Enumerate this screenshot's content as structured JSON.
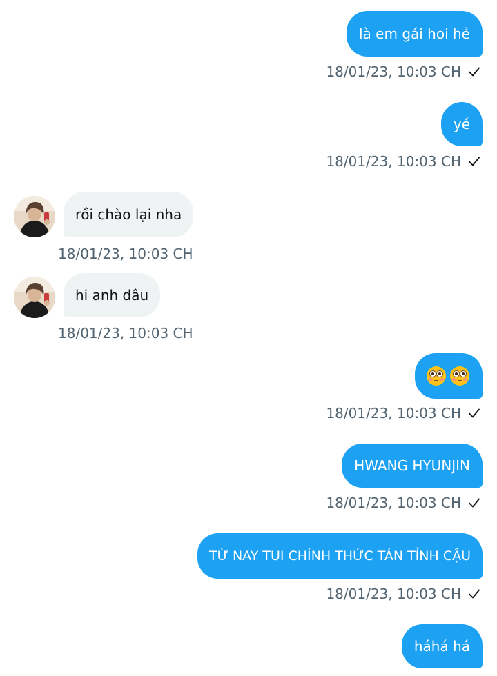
{
  "messages": [
    {
      "side": "sent",
      "text": "là em gái hoi hẻ",
      "time": "18/01/23,  10:03 CH"
    },
    {
      "side": "sent",
      "text": "yé",
      "time": "18/01/23,  10:03 CH"
    },
    {
      "side": "received",
      "text": "rồi chào lại nha",
      "time": "18/01/23,  10:03 CH"
    },
    {
      "side": "received",
      "text": "hi anh dâu",
      "time": "18/01/23,  10:03 CH"
    },
    {
      "side": "sent",
      "emoji": [
        "flushed-face",
        "flushed-face"
      ],
      "time": "18/01/23,  10:03 CH"
    },
    {
      "side": "sent",
      "text": "HWANG HYUNJIN",
      "time": "18/01/23,  10:03 CH"
    },
    {
      "side": "sent",
      "text": "TỪ NAY TUI CHÍNH THỨC TÁN TỈNH CẬU",
      "time": "18/01/23,  10:03 CH"
    },
    {
      "side": "sent",
      "text": "háhá há",
      "time": ""
    }
  ],
  "colors": {
    "sent_bubble": "#1da1f2",
    "received_bubble": "#eff3f4",
    "timestamp": "#536471"
  },
  "icons": {
    "read_status": "check-icon",
    "avatar": "user-avatar"
  }
}
